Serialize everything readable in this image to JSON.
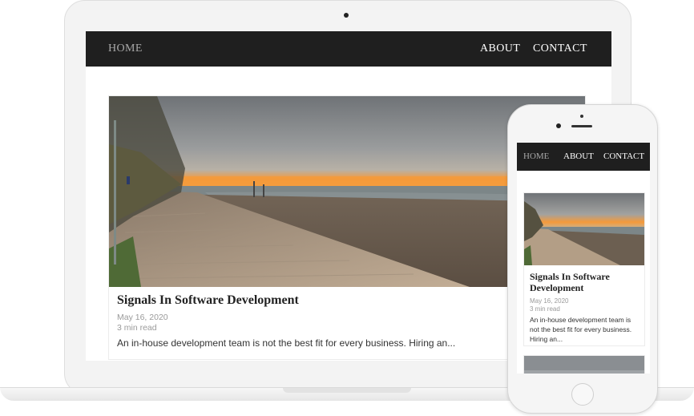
{
  "nav": {
    "home": "HOME",
    "about": "ABOUT",
    "contact": "CONTACT"
  },
  "post": {
    "title": "Signals In Software Development",
    "date": "May 16, 2020",
    "read_time": "3 min read",
    "excerpt": "An in-house development team is not the best fit for every business. Hiring an..."
  },
  "mobile_post": {
    "title": "Signals In Software Development",
    "date": "May 16, 2020",
    "read_time": "3 min read",
    "excerpt": "An in-house development team is not the best fit for every business. Hiring an..."
  },
  "colors": {
    "nav_bg": "#1f1f1f",
    "nav_active": "#a8a8a8",
    "sunset": "#f59a3a"
  }
}
